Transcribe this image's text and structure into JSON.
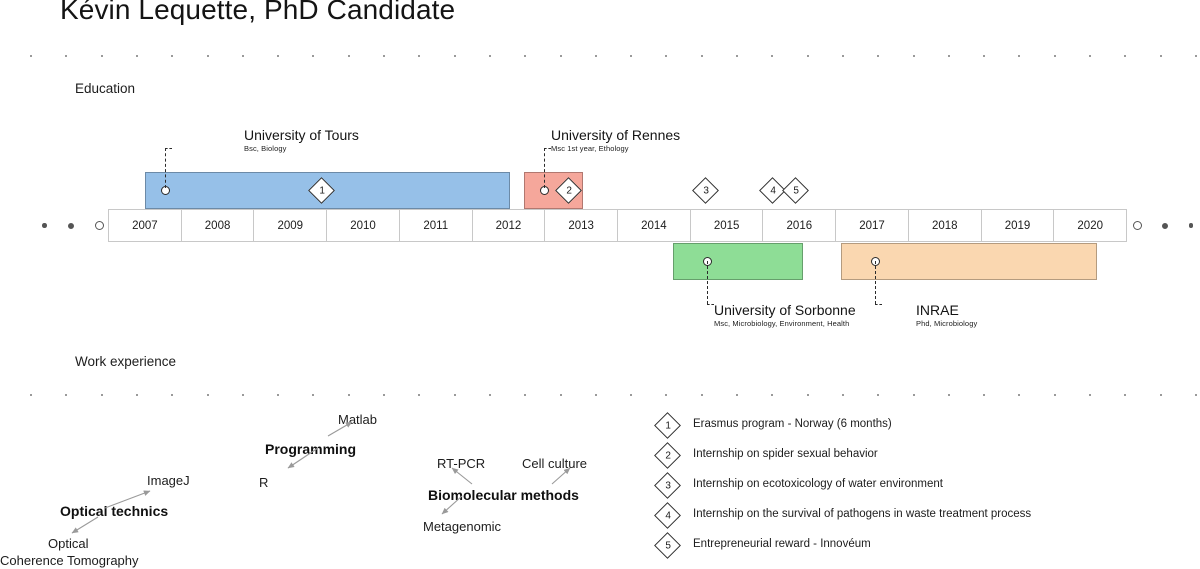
{
  "title": "Kévin Lequette, PhD Candidate",
  "sections": {
    "education_label": "Education",
    "work_label": "Work experience"
  },
  "timeline": {
    "years": [
      "2007",
      "2008",
      "2009",
      "2010",
      "2011",
      "2012",
      "2013",
      "2014",
      "2015",
      "2016",
      "2017",
      "2018",
      "2019",
      "2020"
    ],
    "periods": [
      {
        "id": "tours",
        "institution": "University of Tours",
        "detail": "Bsc, Biology",
        "color": "#96C0E8",
        "start_year": "2007",
        "end_year": "2012",
        "position": "above"
      },
      {
        "id": "rennes",
        "institution": "University of Rennes",
        "detail": "Msc 1st year, Ethology",
        "color": "#F5A79B",
        "start_year": "2012",
        "end_year": "2013",
        "position": "above"
      },
      {
        "id": "sorbonne",
        "institution": "University of Sorbonne",
        "detail": "Msc, Microbiology, Environment, Health",
        "color": "#8EDD96",
        "start_year": "2014",
        "end_year": "2016",
        "position": "below"
      },
      {
        "id": "inrae",
        "institution": "INRAE",
        "detail": "Phd, Microbiology",
        "color": "#FAD7B0",
        "start_year": "2017",
        "end_year": "2020",
        "position": "below"
      }
    ],
    "milestones": [
      {
        "number": "1"
      },
      {
        "number": "2"
      },
      {
        "number": "3"
      },
      {
        "number": "4"
      },
      {
        "number": "5"
      }
    ]
  },
  "legend": [
    {
      "number": "1",
      "text": "Erasmus program - Norway (6 months)"
    },
    {
      "number": "2",
      "text": "Internship on spider sexual behavior"
    },
    {
      "number": "3",
      "text": "Internship on ecotoxicology of water environment"
    },
    {
      "number": "4",
      "text": "Internship on the survival of pathogens in waste treatment process"
    },
    {
      "number": "5",
      "text": "Entrepreneurial reward - Innovéum"
    }
  ],
  "skills": {
    "optical": {
      "category": "Optical technics",
      "leaves": [
        "ImageJ",
        "Optical\nCoherence Tomography"
      ]
    },
    "programming": {
      "category": "Programming",
      "leaves": [
        "Matlab",
        "R"
      ]
    },
    "biomolecular": {
      "category": "Biomolecular methods",
      "leaves": [
        "RT-PCR",
        "Cell culture",
        "Metagenomic"
      ]
    },
    "labels": {
      "imagej": "ImageJ",
      "oct_line1": "Optical",
      "oct_line2": "Coherence Tomography",
      "matlab": "Matlab",
      "r": "R",
      "rtpcr": "RT-PCR",
      "cellculture": "Cell culture",
      "metagenomic": "Metagenomic",
      "optical_cat": "Optical technics",
      "programming_cat": "Programming",
      "biomolecular_cat": "Biomolecular methods"
    }
  },
  "colors": {
    "blue": "#96C0E8",
    "red": "#F5A79B",
    "green": "#8EDD96",
    "orange": "#FAD7B0",
    "axis_border": "#c8c8c8",
    "text": "#1d1d1d"
  }
}
